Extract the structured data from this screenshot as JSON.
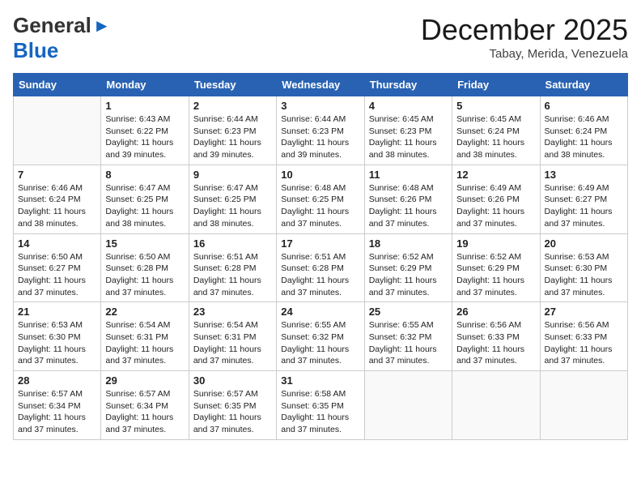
{
  "header": {
    "logo_general": "General",
    "logo_blue": "Blue",
    "month_title": "December 2025",
    "location": "Tabay, Merida, Venezuela"
  },
  "calendar": {
    "headers": [
      "Sunday",
      "Monday",
      "Tuesday",
      "Wednesday",
      "Thursday",
      "Friday",
      "Saturday"
    ],
    "weeks": [
      [
        {
          "day": "",
          "info": ""
        },
        {
          "day": "1",
          "info": "Sunrise: 6:43 AM\nSunset: 6:22 PM\nDaylight: 11 hours and 39 minutes."
        },
        {
          "day": "2",
          "info": "Sunrise: 6:44 AM\nSunset: 6:23 PM\nDaylight: 11 hours and 39 minutes."
        },
        {
          "day": "3",
          "info": "Sunrise: 6:44 AM\nSunset: 6:23 PM\nDaylight: 11 hours and 39 minutes."
        },
        {
          "day": "4",
          "info": "Sunrise: 6:45 AM\nSunset: 6:23 PM\nDaylight: 11 hours and 38 minutes."
        },
        {
          "day": "5",
          "info": "Sunrise: 6:45 AM\nSunset: 6:24 PM\nDaylight: 11 hours and 38 minutes."
        },
        {
          "day": "6",
          "info": "Sunrise: 6:46 AM\nSunset: 6:24 PM\nDaylight: 11 hours and 38 minutes."
        }
      ],
      [
        {
          "day": "7",
          "info": "Sunrise: 6:46 AM\nSunset: 6:24 PM\nDaylight: 11 hours and 38 minutes."
        },
        {
          "day": "8",
          "info": "Sunrise: 6:47 AM\nSunset: 6:25 PM\nDaylight: 11 hours and 38 minutes."
        },
        {
          "day": "9",
          "info": "Sunrise: 6:47 AM\nSunset: 6:25 PM\nDaylight: 11 hours and 38 minutes."
        },
        {
          "day": "10",
          "info": "Sunrise: 6:48 AM\nSunset: 6:25 PM\nDaylight: 11 hours and 37 minutes."
        },
        {
          "day": "11",
          "info": "Sunrise: 6:48 AM\nSunset: 6:26 PM\nDaylight: 11 hours and 37 minutes."
        },
        {
          "day": "12",
          "info": "Sunrise: 6:49 AM\nSunset: 6:26 PM\nDaylight: 11 hours and 37 minutes."
        },
        {
          "day": "13",
          "info": "Sunrise: 6:49 AM\nSunset: 6:27 PM\nDaylight: 11 hours and 37 minutes."
        }
      ],
      [
        {
          "day": "14",
          "info": "Sunrise: 6:50 AM\nSunset: 6:27 PM\nDaylight: 11 hours and 37 minutes."
        },
        {
          "day": "15",
          "info": "Sunrise: 6:50 AM\nSunset: 6:28 PM\nDaylight: 11 hours and 37 minutes."
        },
        {
          "day": "16",
          "info": "Sunrise: 6:51 AM\nSunset: 6:28 PM\nDaylight: 11 hours and 37 minutes."
        },
        {
          "day": "17",
          "info": "Sunrise: 6:51 AM\nSunset: 6:28 PM\nDaylight: 11 hours and 37 minutes."
        },
        {
          "day": "18",
          "info": "Sunrise: 6:52 AM\nSunset: 6:29 PM\nDaylight: 11 hours and 37 minutes."
        },
        {
          "day": "19",
          "info": "Sunrise: 6:52 AM\nSunset: 6:29 PM\nDaylight: 11 hours and 37 minutes."
        },
        {
          "day": "20",
          "info": "Sunrise: 6:53 AM\nSunset: 6:30 PM\nDaylight: 11 hours and 37 minutes."
        }
      ],
      [
        {
          "day": "21",
          "info": "Sunrise: 6:53 AM\nSunset: 6:30 PM\nDaylight: 11 hours and 37 minutes."
        },
        {
          "day": "22",
          "info": "Sunrise: 6:54 AM\nSunset: 6:31 PM\nDaylight: 11 hours and 37 minutes."
        },
        {
          "day": "23",
          "info": "Sunrise: 6:54 AM\nSunset: 6:31 PM\nDaylight: 11 hours and 37 minutes."
        },
        {
          "day": "24",
          "info": "Sunrise: 6:55 AM\nSunset: 6:32 PM\nDaylight: 11 hours and 37 minutes."
        },
        {
          "day": "25",
          "info": "Sunrise: 6:55 AM\nSunset: 6:32 PM\nDaylight: 11 hours and 37 minutes."
        },
        {
          "day": "26",
          "info": "Sunrise: 6:56 AM\nSunset: 6:33 PM\nDaylight: 11 hours and 37 minutes."
        },
        {
          "day": "27",
          "info": "Sunrise: 6:56 AM\nSunset: 6:33 PM\nDaylight: 11 hours and 37 minutes."
        }
      ],
      [
        {
          "day": "28",
          "info": "Sunrise: 6:57 AM\nSunset: 6:34 PM\nDaylight: 11 hours and 37 minutes."
        },
        {
          "day": "29",
          "info": "Sunrise: 6:57 AM\nSunset: 6:34 PM\nDaylight: 11 hours and 37 minutes."
        },
        {
          "day": "30",
          "info": "Sunrise: 6:57 AM\nSunset: 6:35 PM\nDaylight: 11 hours and 37 minutes."
        },
        {
          "day": "31",
          "info": "Sunrise: 6:58 AM\nSunset: 6:35 PM\nDaylight: 11 hours and 37 minutes."
        },
        {
          "day": "",
          "info": ""
        },
        {
          "day": "",
          "info": ""
        },
        {
          "day": "",
          "info": ""
        }
      ]
    ]
  }
}
